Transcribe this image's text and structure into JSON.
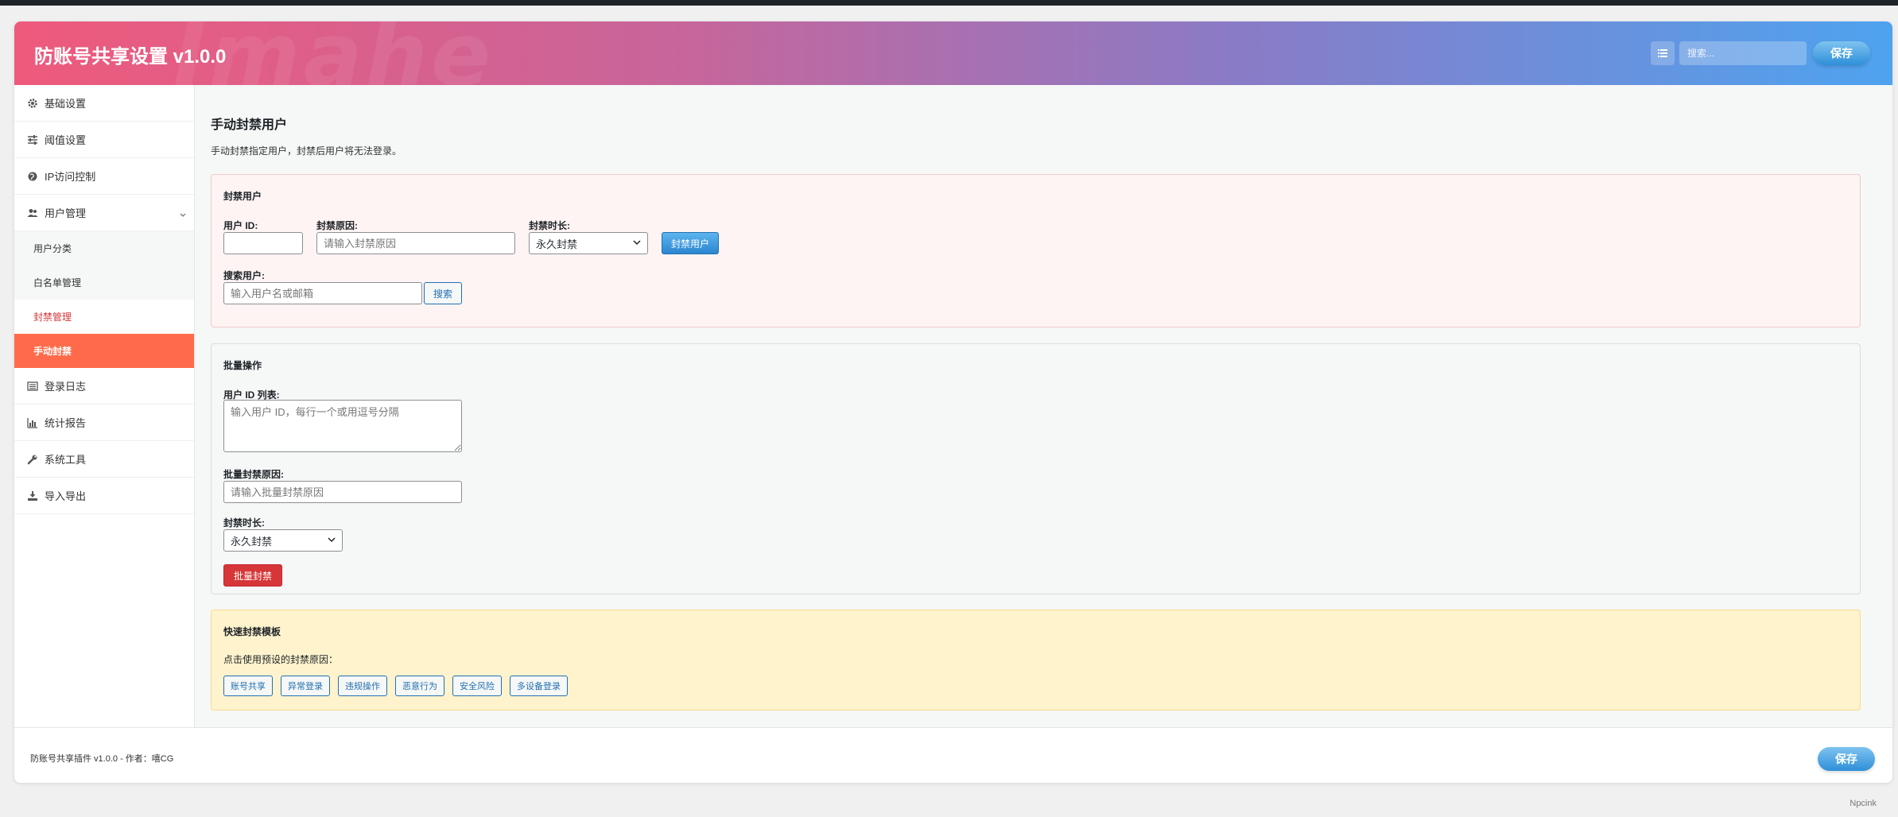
{
  "header": {
    "title": "防账号共享设置 v1.0.0",
    "watermark": "Imahe",
    "search_placeholder": "搜索...",
    "save_label": "保存"
  },
  "sidebar": {
    "items": [
      {
        "label": "基础设置",
        "icon": "gear-icon"
      },
      {
        "label": "阈值设置",
        "icon": "sliders-icon"
      },
      {
        "label": "IP访问控制",
        "icon": "globe-icon"
      },
      {
        "label": "用户管理",
        "icon": "users-icon"
      },
      {
        "label": "登录日志",
        "icon": "list-icon"
      },
      {
        "label": "统计报告",
        "icon": "bar-chart-icon"
      },
      {
        "label": "系统工具",
        "icon": "wrench-icon"
      },
      {
        "label": "导入导出",
        "icon": "download-icon"
      }
    ],
    "subitems": [
      {
        "label": "用户分类"
      },
      {
        "label": "白名单管理"
      },
      {
        "label": "封禁管理"
      },
      {
        "label": "手动封禁"
      }
    ]
  },
  "main": {
    "title": "手动封禁用户",
    "description": "手动封禁指定用户，封禁后用户将无法登录。",
    "ban_box": {
      "title": "封禁用户",
      "user_id_label": "用户 ID:",
      "user_id_value": "",
      "reason_label": "封禁原因:",
      "reason_placeholder": "请输入封禁原因",
      "duration_label": "封禁时长:",
      "duration_value": "永久封禁",
      "ban_button": "封禁用户",
      "search_label": "搜索用户:",
      "search_placeholder": "输入用户名或邮箱",
      "search_button": "搜索"
    },
    "batch_box": {
      "title": "批量操作",
      "ids_label": "用户 ID 列表:",
      "ids_placeholder": "输入用户 ID，每行一个或用逗号分隔",
      "reason_label": "批量封禁原因:",
      "reason_placeholder": "请输入批量封禁原因",
      "duration_label": "封禁时长:",
      "duration_value": "永久封禁",
      "batch_button": "批量封禁"
    },
    "templates_box": {
      "title": "快速封禁模板",
      "hint": "点击使用预设的封禁原因：",
      "templates": [
        "账号共享",
        "异常登录",
        "违规操作",
        "恶意行为",
        "安全风险",
        "多设备登录"
      ]
    }
  },
  "footer": {
    "text": "防账号共享插件 v1.0.0 - 作者：嘻CG",
    "save_label": "保存"
  },
  "corner_watermark": "Npcink",
  "colors": {
    "active_nav": "#ff6b4a",
    "danger": "#d63638",
    "primary": "#2271b1"
  }
}
